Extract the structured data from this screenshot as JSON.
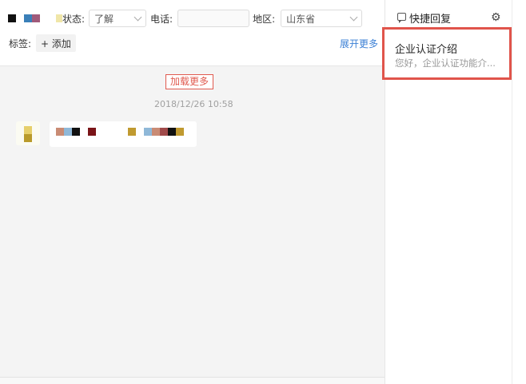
{
  "header": {
    "status_label": "状态:",
    "status_value": "了解",
    "phone_label": "电话:",
    "phone_value": "",
    "region_label": "地区:",
    "region_value": "山东省",
    "tags_label": "标签:",
    "add_tag_label": "+ 添加",
    "expand_more_label": "展开更多"
  },
  "chat": {
    "load_more_label": "加载更多",
    "timestamp": "2018/12/26 10:58"
  },
  "quick_reply": {
    "title": "快捷回复",
    "items": [
      {
        "title": "企业认证介绍",
        "preview": "您好，企业认证功能介..."
      }
    ]
  },
  "colors": {
    "accent_blue": "#3a7fd5",
    "highlight_red": "#e0544b",
    "load_more_red": "#e05a4f"
  },
  "icons": {
    "status_dropdown": "chevron-down-icon",
    "region_dropdown": "chevron-down-icon",
    "quick_reply": "message-icon",
    "settings": "gear-icon"
  }
}
